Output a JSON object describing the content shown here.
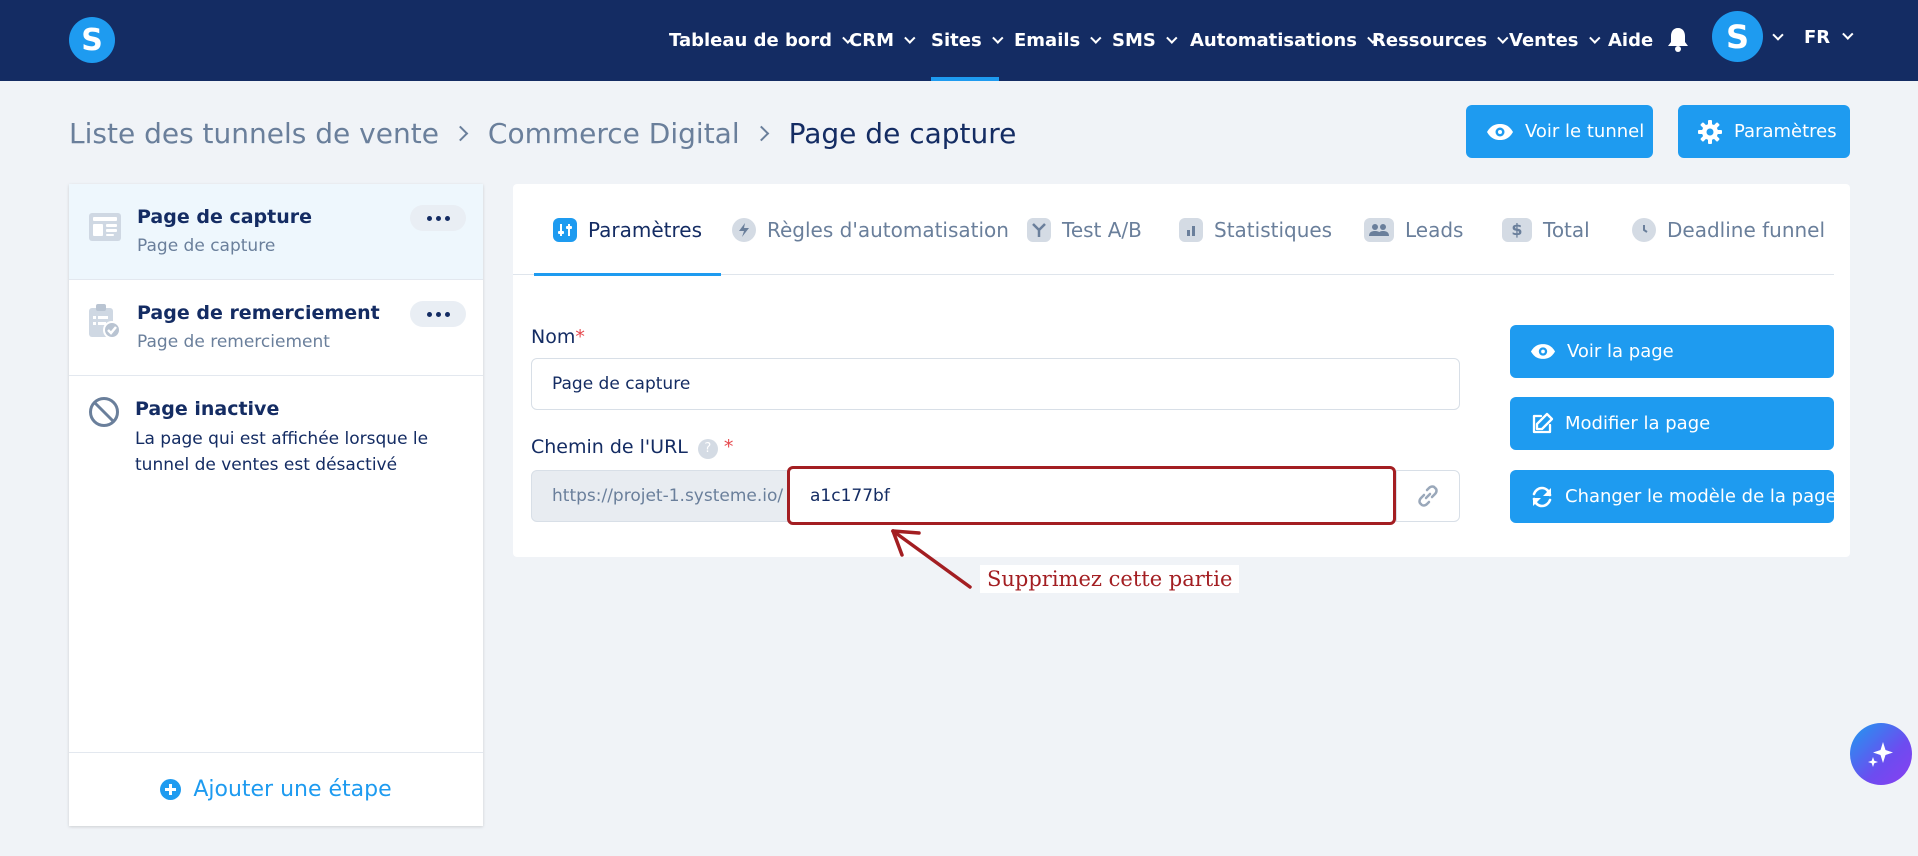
{
  "nav": {
    "logo_letter": "S",
    "items": [
      {
        "label": "Tableau de bord"
      },
      {
        "label": "CRM"
      },
      {
        "label": "Sites"
      },
      {
        "label": "Emails"
      },
      {
        "label": "SMS"
      },
      {
        "label": "Automatisations"
      },
      {
        "label": "Ressources"
      },
      {
        "label": "Ventes"
      },
      {
        "label": "Aide"
      }
    ],
    "active_item": "Sites",
    "avatar_letter": "S",
    "language": "FR"
  },
  "breadcrumb": {
    "items": [
      "Liste des tunnels de vente",
      "Commerce Digital"
    ],
    "current": "Page de capture"
  },
  "header_buttons": {
    "view_funnel": "Voir le tunnel",
    "settings": "Paramètres"
  },
  "steps": [
    {
      "title": "Page de capture",
      "subtitle": "Page de capture",
      "icon": "page-layout-icon",
      "active": true
    },
    {
      "title": "Page de remerciement",
      "subtitle": "Page de remerciement",
      "icon": "clipboard-check-icon",
      "active": false
    }
  ],
  "inactive_page": {
    "title": "Page inactive",
    "description": "La page qui est affichée lorsque le tunnel de ventes est désactivé"
  },
  "add_step_label": "Ajouter une étape",
  "tabs": [
    {
      "label": "Paramètres",
      "icon": "sliders-icon"
    },
    {
      "label": "Règles d'automatisation",
      "icon": "bolt-icon"
    },
    {
      "label": "Test A/B",
      "icon": "split-icon"
    },
    {
      "label": "Statistiques",
      "icon": "bar-chart-icon"
    },
    {
      "label": "Leads",
      "icon": "users-icon"
    },
    {
      "label": "Total",
      "icon": "dollar-icon"
    },
    {
      "label": "Deadline funnel",
      "icon": "clock-icon"
    }
  ],
  "active_tab": "Paramètres",
  "form": {
    "name_label": "Nom",
    "name_value": "Page de capture",
    "required_mark": "*",
    "url_label": "Chemin de l'URL",
    "help_mark": "?",
    "url_prefix": "https://projet-1.systeme.io/",
    "url_path": "a1c177bf"
  },
  "action_buttons": {
    "view_page": "Voir la page",
    "edit_page": "Modifier la page",
    "change_template": "Changer le modèle de la page"
  },
  "annotation": {
    "text": "Supprimez cette partie",
    "color": "#a31e22"
  },
  "colors": {
    "primary": "#1e9bf0",
    "navbar": "#142c63",
    "background": "#f0f3f7"
  }
}
